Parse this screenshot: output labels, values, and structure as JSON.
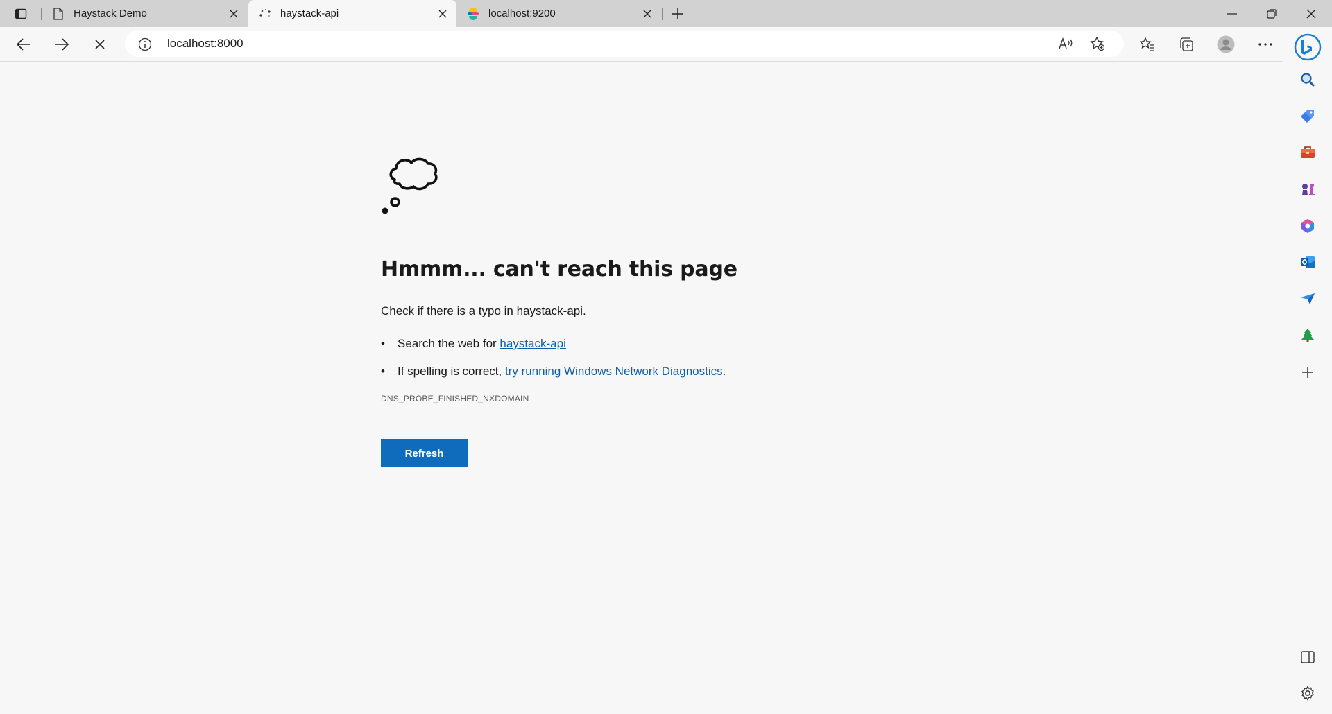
{
  "tabs": [
    {
      "title": "Haystack Demo",
      "icon": "page-icon",
      "active": false
    },
    {
      "title": "haystack-api",
      "icon": "loading-spinner-icon",
      "active": true
    },
    {
      "title": "localhost:9200",
      "icon": "elastic-logo-icon",
      "active": false
    }
  ],
  "address": {
    "url": "localhost:8000"
  },
  "error": {
    "heading": "Hmmm... can't reach this page",
    "subtext": "Check if there is a typo in haystack-api.",
    "bullet1_prefix": "Search the web for ",
    "bullet1_link": "haystack-api",
    "bullet2_prefix": "If spelling is correct, ",
    "bullet2_link": "try running Windows Network Diagnostics",
    "bullet2_suffix": ".",
    "code": "DNS_PROBE_FINISHED_NXDOMAIN",
    "refresh_label": "Refresh"
  },
  "colors": {
    "accent": "#0f6cbd",
    "link": "#0f5fa8",
    "background": "#f7f7f7"
  }
}
